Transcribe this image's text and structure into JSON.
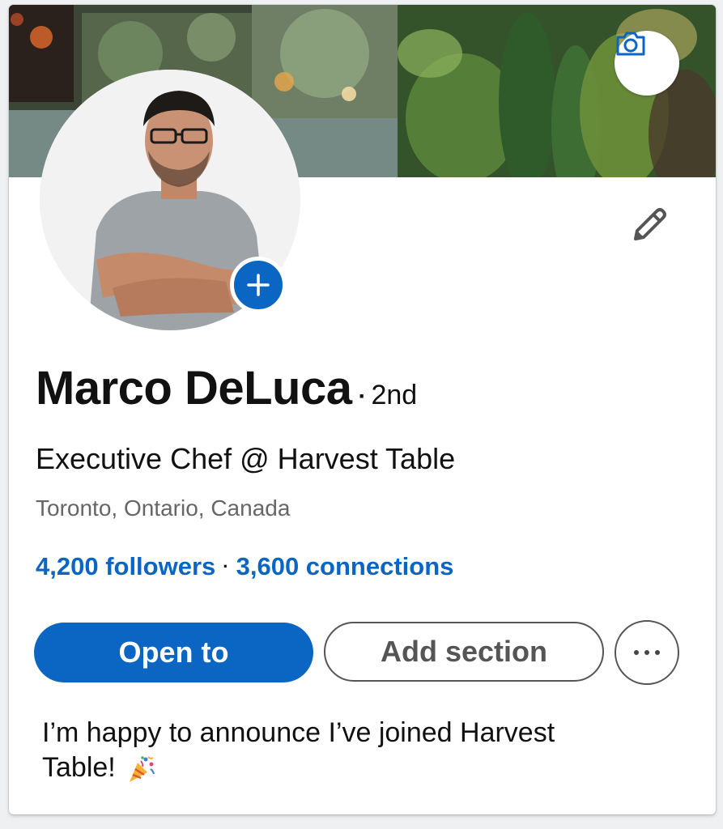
{
  "banner": {
    "camera_icon": "camera-icon"
  },
  "profile": {
    "name": "Marco DeLuca",
    "separator": "·",
    "degree": "2nd",
    "headline": "Executive Chef @ Harvest Table",
    "location": "Toronto, Ontario, Canada",
    "followers": "4,200 followers",
    "stats_separator": "·",
    "connections": "3,600 connections"
  },
  "actions": {
    "primary_label": "Open to",
    "secondary_label": "Add section",
    "more_icon": "more-horizontal-icon"
  },
  "post": {
    "text": "I’m happy to announce I’ve joined Harvest Table!",
    "emoji_icon": "party-popper-icon"
  },
  "colors": {
    "accent": "#0a66c2",
    "text": "#111111",
    "muted": "#666666",
    "outline": "#555555"
  }
}
